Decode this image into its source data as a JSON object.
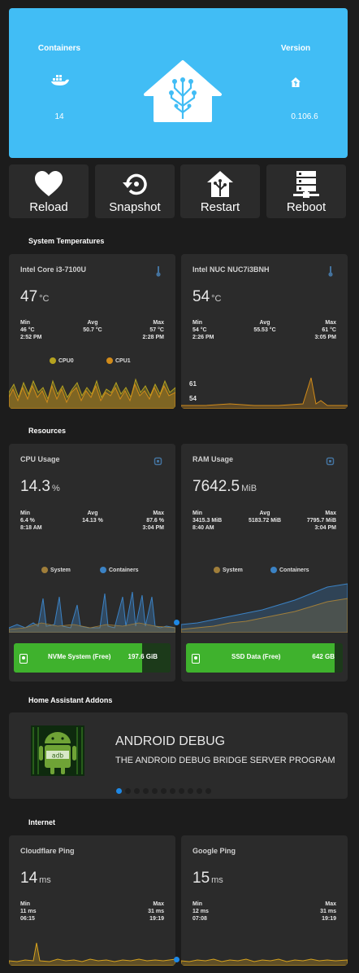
{
  "banner": {
    "containers_label": "Containers",
    "containers_value": "14",
    "version_label": "Version",
    "version_value": "0.106.6",
    "color": "#41bdf5"
  },
  "actions": [
    {
      "label": "Reload",
      "icon": "heart-icon"
    },
    {
      "label": "Snapshot",
      "icon": "restore-icon"
    },
    {
      "label": "Restart",
      "icon": "home-assistant-icon"
    },
    {
      "label": "Reboot",
      "icon": "server-network-icon"
    }
  ],
  "sections": {
    "temps": "System Temperatures",
    "resources": "Resources",
    "addons": "Home Assistant Addons",
    "internet": "Internet"
  },
  "temp_cards": [
    {
      "title": "Intel Core i3-7100U",
      "value": "47",
      "unit": "°C",
      "min_label": "Min",
      "min": "46 °C",
      "min_time": "2:52 PM",
      "avg_label": "Avg",
      "avg": "50.7 °C",
      "max_label": "Max",
      "max": "57 °C",
      "max_time": "2:28 PM",
      "legend": [
        "CPU0",
        "CPU1"
      ]
    },
    {
      "title": "Intel NUC NUC7i3BNH",
      "value": "54",
      "unit": "°C",
      "min_label": "Min",
      "min": "54 °C",
      "min_time": "2:26 PM",
      "avg_label": "Avg",
      "avg": "55.53 °C",
      "max_label": "Max",
      "max": "61 °C",
      "max_time": "3:05 PM",
      "axis_labels": [
        "61",
        "54"
      ]
    }
  ],
  "resource_cards": [
    {
      "title": "CPU Usage",
      "value": "14.3",
      "unit": "%",
      "min_label": "Min",
      "min": "6.4 %",
      "min_time": "8:18 AM",
      "avg_label": "Avg",
      "avg": "14.13 %",
      "max_label": "Max",
      "max": "87.6 %",
      "max_time": "3:04 PM",
      "legend": [
        "System",
        "Containers"
      ]
    },
    {
      "title": "RAM Usage",
      "value": "7642.5",
      "unit": "MiB",
      "min_label": "Min",
      "min": "3415.3 MiB",
      "min_time": "8:40 AM",
      "avg_label": "Avg",
      "avg": "5183.72 MiB",
      "max_label": "Max",
      "max": "7795.7 MiB",
      "max_time": "3:04 PM",
      "legend": [
        "System",
        "Containers"
      ]
    }
  ],
  "storage": [
    {
      "label": "NVMe System (Free)",
      "value": "197.6 GiB",
      "fraction": 0.82
    },
    {
      "label": "SSD Data (Free)",
      "value": "642 GB",
      "fraction": 0.95
    }
  ],
  "addon": {
    "title": "ANDROID DEBUG",
    "subtitle": "THE ANDROID DEBUG BRIDGE SERVER PROGRAM",
    "pages": 11,
    "active_page": 0
  },
  "ping_cards": [
    {
      "title": "Cloudflare Ping",
      "value": "14",
      "unit": "ms",
      "min_label": "Min",
      "min": "11 ms",
      "min_time": "06:15",
      "max_label": "Max",
      "max": "31 ms",
      "max_time": "19:19"
    },
    {
      "title": "Google Ping",
      "value": "15",
      "unit": "ms",
      "min_label": "Min",
      "min": "12 ms",
      "min_time": "07:08",
      "max_label": "Max",
      "max": "31 ms",
      "max_time": "19:19"
    }
  ],
  "colors": {
    "card": "#2b2b2b",
    "background": "#1c1c1c",
    "cpu0": "#b5a21f",
    "cpu1": "#d18b1a",
    "system": "#a07e3a",
    "containers": "#3b82c4",
    "storage_fill": "#3fb22d",
    "ping": "#d7a21d"
  }
}
